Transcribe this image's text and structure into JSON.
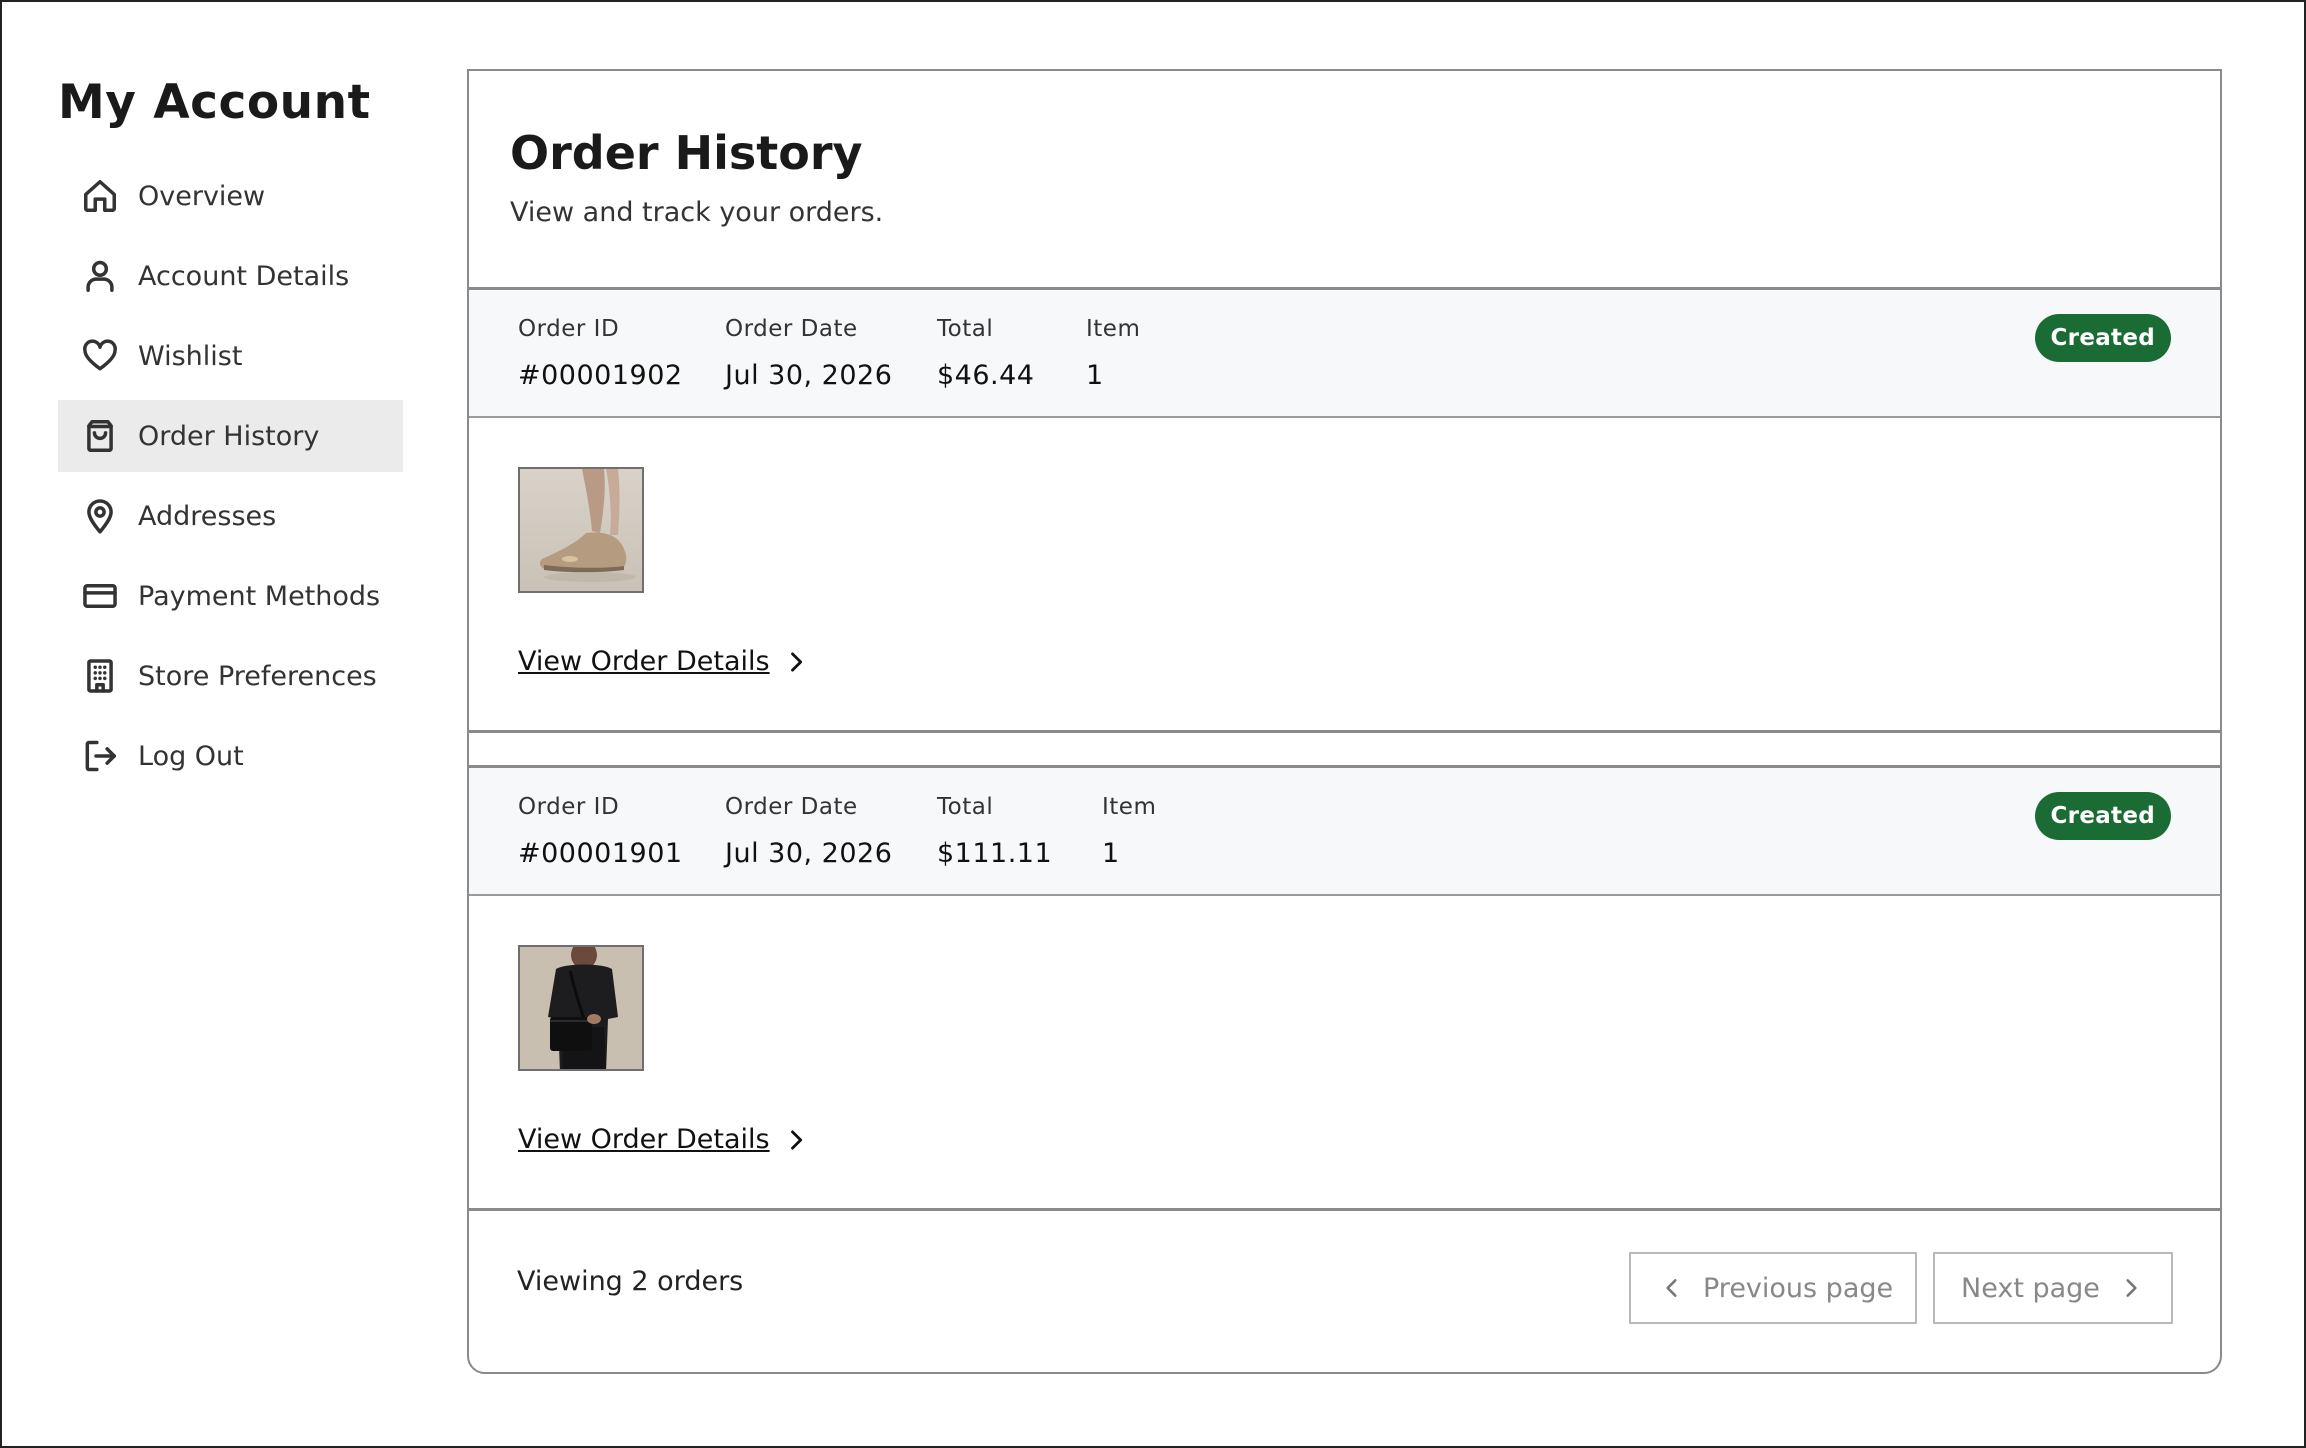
{
  "sidebar": {
    "title": "My Account",
    "items": [
      {
        "label": "Overview",
        "icon": "home-icon"
      },
      {
        "label": "Account Details",
        "icon": "user-icon"
      },
      {
        "label": "Wishlist",
        "icon": "heart-icon"
      },
      {
        "label": "Order History",
        "icon": "shopping-bag-icon",
        "active": true
      },
      {
        "label": "Addresses",
        "icon": "map-pin-icon"
      },
      {
        "label": "Payment Methods",
        "icon": "credit-card-icon"
      },
      {
        "label": "Store Preferences",
        "icon": "building-icon"
      },
      {
        "label": "Log Out",
        "icon": "log-out-icon"
      }
    ]
  },
  "main": {
    "title": "Order History",
    "subtitle": "View and track your orders.",
    "labels": {
      "order_id": "Order ID",
      "order_date": "Order Date",
      "total": "Total",
      "item": "Item"
    },
    "orders": [
      {
        "id": "#00001902",
        "date": "Jul 30, 2026",
        "total": "$46.44",
        "items": "1",
        "status": "Created",
        "image": "beige-flat-shoe-image",
        "link": "View Order Details"
      },
      {
        "id": "#00001901",
        "date": "Jul 30, 2026",
        "total": "$111.11",
        "items": "1",
        "status": "Created",
        "image": "black-shoulder-bag-image",
        "link": "View Order Details"
      }
    ],
    "footer": {
      "count_text": "Viewing 2 orders",
      "prev_label": "Previous page",
      "next_label": "Next page"
    }
  },
  "colors": {
    "status_badge": "#1b6b35",
    "active_nav_bg": "#ebebeb",
    "order_header_bg": "#f7f8f9"
  }
}
